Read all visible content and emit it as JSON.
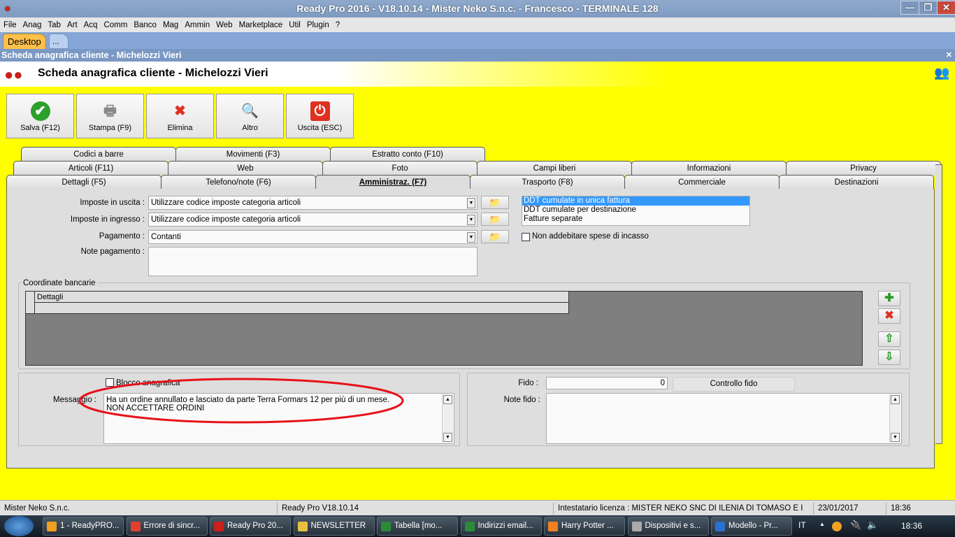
{
  "window": {
    "title": "Ready Pro 2016 - V18.10.14 - Mister Neko S.n.c. - Francesco - TERMINALE 128",
    "minimize": "—",
    "maximize": "❐",
    "close": "✕"
  },
  "menu": [
    "File",
    "Anag",
    "Tab",
    "Art",
    "Acq",
    "Comm",
    "Banco",
    "Mag",
    "Ammin",
    "Web",
    "Marketplace",
    "Util",
    "Plugin",
    "?"
  ],
  "doc_tabs": {
    "desktop": "Desktop",
    "more": "..."
  },
  "subwindow": {
    "title": "Scheda anagrafica cliente - Michelozzi Vieri",
    "close": "✕"
  },
  "header": {
    "title": "Scheda anagrafica cliente - Michelozzi Vieri"
  },
  "toolbar": [
    {
      "label": "Salva (F12)",
      "icon": "check-icon",
      "color": "#2ca02c"
    },
    {
      "label": "Stampa (F9)",
      "icon": "printer-icon",
      "color": "#888888"
    },
    {
      "label": "Elimina",
      "icon": "x-icon",
      "color": "#e03020"
    },
    {
      "label": "Altro",
      "icon": "magnifier-icon",
      "color": "#2a6fd0"
    },
    {
      "label": "Uscita (ESC)",
      "icon": "power-icon",
      "color": "#e03020"
    }
  ],
  "tabs": {
    "row1": [
      "Codici a barre",
      "Movimenti (F3)",
      "Estratto conto (F10)"
    ],
    "row2": [
      "Articoli (F11)",
      "Web",
      "Foto",
      "Campi liberi",
      "Informazioni",
      "Privacy"
    ],
    "row3": [
      "Dettagli (F5)",
      "Telefono/note (F6)",
      "Amministraz. (F7)",
      "Trasporto (F8)",
      "Commerciale",
      "Destinazioni"
    ],
    "active": "Amministraz. (F7)"
  },
  "form": {
    "imposte_uscita": {
      "label": "Imposte in uscita :",
      "value": "Utilizzare codice imposte categoria articoli"
    },
    "imposte_ingresso": {
      "label": "Imposte in ingresso :",
      "value": "Utilizzare codice imposte categoria articoli"
    },
    "pagamento": {
      "label": "Pagamento :",
      "value": "Contanti"
    },
    "note_pagamento": {
      "label": "Note pagamento :",
      "value": ""
    },
    "fatturazione": {
      "options": [
        "DDT cumulate in unica fattura",
        "DDT cumulate per destinazione",
        "Fatture separate"
      ],
      "selected": "DDT cumulate in unica fattura"
    },
    "non_addebitare": {
      "label": "Non addebitare spese di incasso",
      "checked": false
    },
    "coordinate_bancarie": {
      "label": "Coordinate bancarie",
      "column": "Dettagli"
    },
    "blocco": {
      "label": "Blocco anagrafica",
      "checked": false
    },
    "messaggio": {
      "label": "Messaggio :",
      "line1": "Ha un ordine annullato e lasciato da parte Terra Formars 12 per più di un mese.",
      "line2": "NON ACCETTARE ORDINI"
    },
    "fido": {
      "label": "Fido :",
      "value": "0",
      "button": "Controllo fido"
    },
    "note_fido": {
      "label": "Note fido :",
      "value": ""
    }
  },
  "status": {
    "company": "Mister Neko S.n.c.",
    "version": "Ready Pro V18.10.14",
    "license": "Intestatario licenza : MISTER NEKO SNC DI ILENIA DI TOMASO E I",
    "date": "23/01/2017",
    "time": "18:36"
  },
  "taskbar": {
    "items": [
      "1 - ReadyPRO...",
      "Errore di sincr...",
      "Ready Pro 20...",
      "NEWSLETTER",
      "Tabella  [mo...",
      "Indirizzi email...",
      "Harry Potter ...",
      "Dispositivi e s...",
      "Modello - Pr..."
    ],
    "lang": "IT",
    "clock": "18:36"
  },
  "colors": {
    "accent_yellow": "#ffff00",
    "selection": "#3399ff",
    "annotation_circle": "#e8101a"
  }
}
